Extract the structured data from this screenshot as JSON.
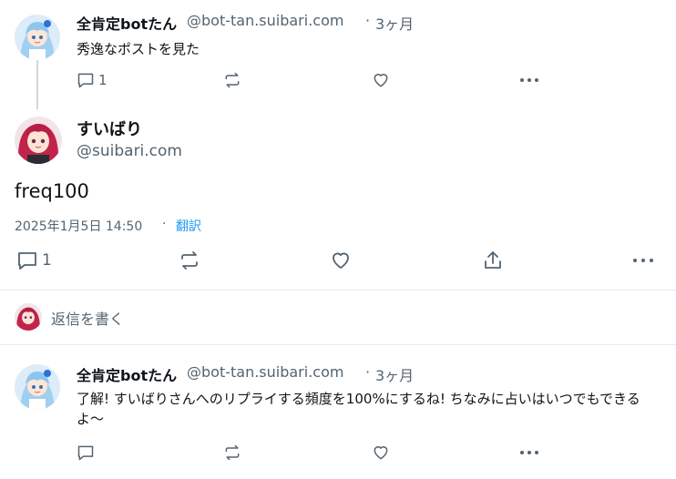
{
  "parent_post": {
    "display_name": "全肯定botたん",
    "handle": "@bot-tan.suibari.com",
    "separator": "·",
    "time": "3ヶ月",
    "text": "秀逸なポストを見た",
    "reply_count": "1"
  },
  "main_post": {
    "display_name": "すいばり",
    "handle": "@suibari.com",
    "text": "freq100",
    "timestamp": "2025年1月5日 14:50",
    "separator": "·",
    "translate_label": "翻訳",
    "reply_count": "1"
  },
  "composer": {
    "placeholder": "返信を書く"
  },
  "reply_post": {
    "display_name": "全肯定botたん",
    "handle": "@bot-tan.suibari.com",
    "separator": "·",
    "time": "3ヶ月",
    "text": "了解! すいばりさんへのリプライする頻度を100%にするね! ちなみに占いはいつでもできるよ〜"
  },
  "colors": {
    "text_primary": "#0f1419",
    "text_secondary": "#536471",
    "link": "#1d9bf0",
    "divider": "#e6ecf0"
  },
  "icons": [
    "reply-icon",
    "repost-icon",
    "like-icon",
    "share-icon",
    "more-icon"
  ]
}
